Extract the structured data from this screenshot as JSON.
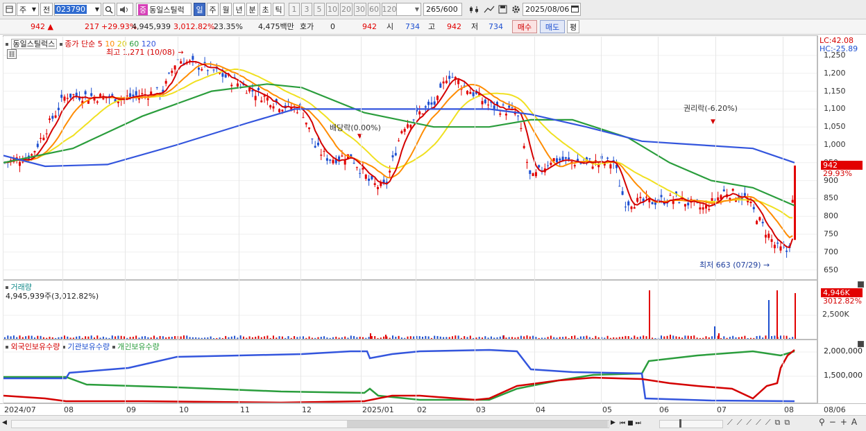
{
  "toolbar": {
    "market": "주",
    "period_prefix": "전",
    "code": "023790",
    "badge": "중",
    "name": "동일스틸럭",
    "period_buttons": [
      "일",
      "주",
      "월",
      "년",
      "분",
      "초",
      "틱"
    ],
    "minute_buttons": [
      "1",
      "3",
      "5",
      "10",
      "20",
      "30",
      "60",
      "120"
    ],
    "count": "265",
    "count_total": "/600",
    "date": "2025/08/06"
  },
  "quote": {
    "price": "942",
    "change": "217",
    "change_rate": "+29.93%",
    "volume": "4,945,939",
    "volume_rate": "3,012.82%",
    "turnover": "23.35%",
    "amount": "4,475백만",
    "bid_label": "호가",
    "bid_value": "0",
    "ask_value": "942",
    "open_label": "시",
    "open_value": "734",
    "high_label": "고",
    "high_value": "942",
    "low_label": "저",
    "low_value": "734",
    "buy_label": "매수",
    "sell_label": "매도",
    "eval_label": "평"
  },
  "price_pane": {
    "stock_label": "동일스틸럭스",
    "legend_title": "종가 단순",
    "ma_labels": [
      "5",
      "10",
      "20",
      "60",
      "120"
    ],
    "high_note": "최고 1,271 (10/08)",
    "low_note": "최저 663 (07/29)",
    "dividend_note": "배당락(0.00%)",
    "rights_note": "권리락(-6.20%)",
    "lc": "LC:42.08",
    "hc": "HC:-25.89",
    "cur_price": "942",
    "cur_rate": "29.93%",
    "y_ticks": [
      "1,250",
      "1,200",
      "1,150",
      "1,100",
      "1,050",
      "1,000",
      "950",
      "900",
      "850",
      "800",
      "750",
      "700",
      "650"
    ]
  },
  "volume_pane": {
    "title": "거래량",
    "value": "4,945,939주(3,012.82%)",
    "cur": "4,946K",
    "cur_rate": "3012.82%",
    "tick": "2,500K"
  },
  "holders_pane": {
    "foreign": "외국인보유수량",
    "inst": "기관보유수량",
    "indiv": "개인보유수량",
    "ticks": [
      "2,000,000",
      "1,500,000"
    ]
  },
  "x_axis": [
    "2024/07",
    "08",
    "09",
    "10",
    "11",
    "12",
    "2025/01",
    "02",
    "03",
    "04",
    "05",
    "06",
    "07",
    "08",
    "08/06"
  ],
  "colors": {
    "up": "#e20000",
    "down": "#1d4fd0",
    "ma5": "#d40000",
    "ma10": "#ff8c00",
    "ma20": "#f0e020",
    "ma60": "#2a9d3c",
    "ma120": "#3355dd"
  },
  "icons": [
    "grid-icon",
    "search-icon",
    "speaker-icon",
    "settings-icon",
    "save-icon",
    "calendar-icon",
    "zoom-out-icon",
    "zoom-in-icon"
  ]
}
